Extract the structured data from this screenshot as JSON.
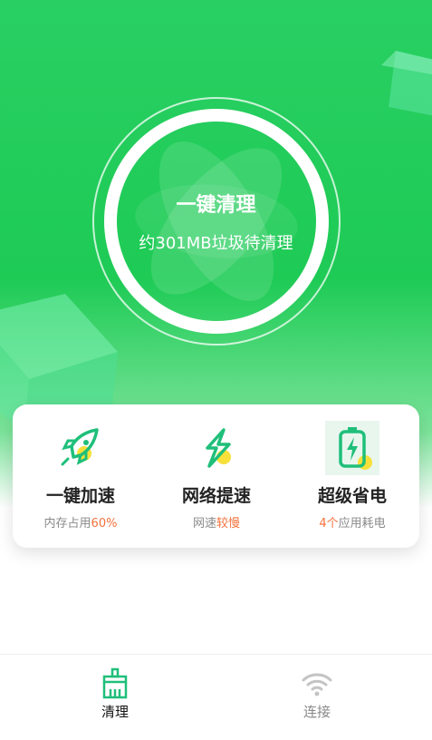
{
  "hero": {
    "title": "一键清理",
    "subtitle": "约301MB垃圾待清理"
  },
  "features": [
    {
      "title": "一键加速",
      "desc_prefix": "内存占用",
      "desc_highlight": "60%",
      "desc_suffix": "",
      "icon": "rocket-icon"
    },
    {
      "title": "网络提速",
      "desc_prefix": "网速",
      "desc_highlight": "较慢",
      "desc_suffix": "",
      "icon": "lightning-icon"
    },
    {
      "title": "超级省电",
      "desc_prefix": "",
      "desc_highlight": "4个",
      "desc_suffix": "应用耗电",
      "icon": "battery-icon"
    }
  ],
  "tabbar": {
    "tabs": [
      {
        "label": "清理",
        "icon": "broom-icon",
        "active": true
      },
      {
        "label": "连接",
        "icon": "wifi-icon",
        "active": false
      }
    ]
  },
  "colors": {
    "hero_green": "#1ecb55",
    "accent_green": "#1fbf7a",
    "highlight_orange": "#f4703a",
    "icon_yellow": "#f7e03a"
  }
}
